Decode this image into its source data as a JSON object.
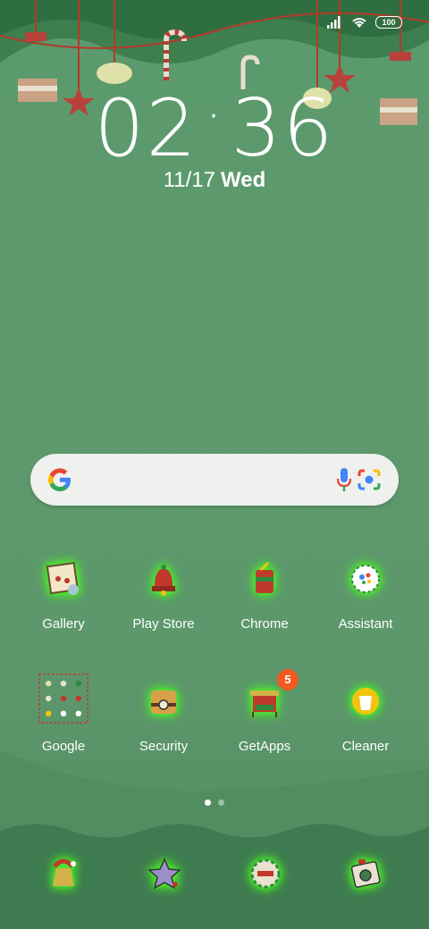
{
  "status_bar": {
    "battery": "100",
    "icons": [
      "signal-icon",
      "wifi-icon",
      "battery-icon"
    ]
  },
  "clock": {
    "hours": "02",
    "minutes": "36"
  },
  "date": {
    "date": "11/17",
    "weekday": "Wed"
  },
  "search_bar": {
    "icons": [
      "google-icon",
      "mic-icon",
      "lens-icon"
    ]
  },
  "apps": [
    {
      "label": "Gallery",
      "icon": "gallery-icon"
    },
    {
      "label": "Play Store",
      "icon": "play-store-icon"
    },
    {
      "label": "Chrome",
      "icon": "chrome-icon"
    },
    {
      "label": "Assistant",
      "icon": "assistant-icon"
    },
    {
      "label": "Google",
      "icon": "google-folder-icon"
    },
    {
      "label": "Security",
      "icon": "security-icon"
    },
    {
      "label": "GetApps",
      "icon": "getapps-icon",
      "badge": "5"
    },
    {
      "label": "Cleaner",
      "icon": "cleaner-icon"
    }
  ],
  "page_indicator": {
    "pages": 2,
    "current": 1
  },
  "dock": [
    "phone-icon",
    "messages-icon",
    "browser-icon",
    "camera-icon"
  ],
  "colors": {
    "background": "#5c976b",
    "glow": "#5dff3b",
    "badge": "#f05a22"
  }
}
